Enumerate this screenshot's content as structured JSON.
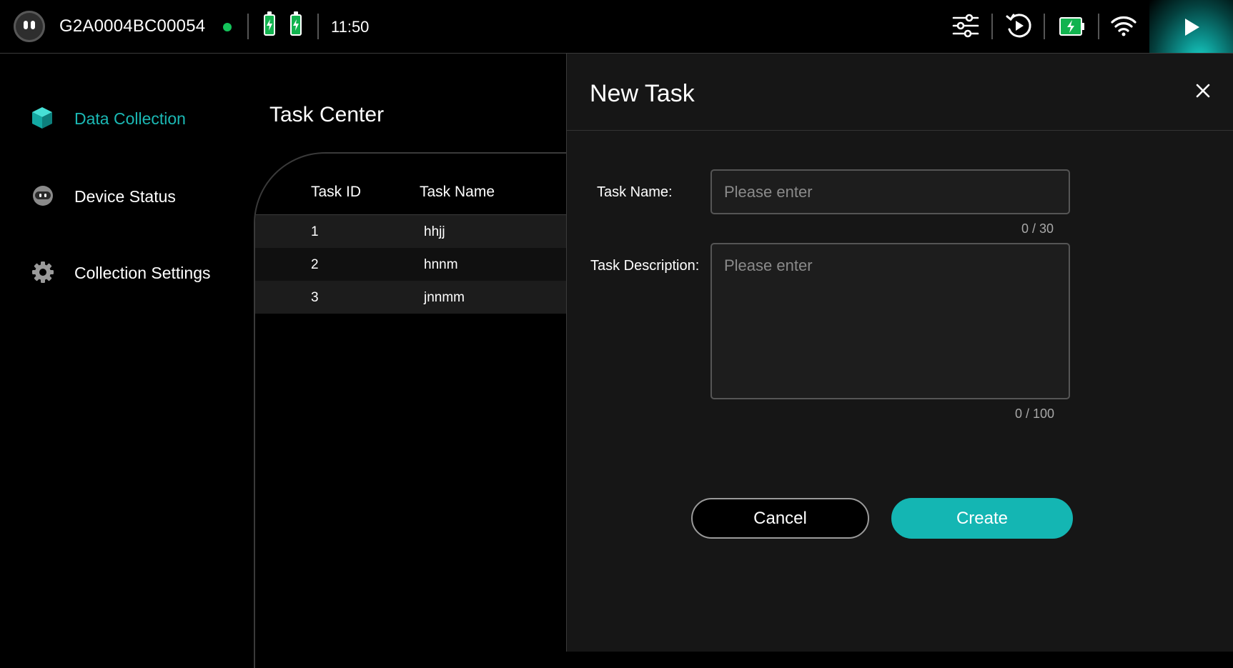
{
  "topbar": {
    "device_id": "G2A0004BC00054",
    "time": "11:50",
    "icons": [
      "logo-icon",
      "online-status-dot",
      "battery-1-icon",
      "battery-2-icon",
      "sliders-icon",
      "replay-icon",
      "charging-battery-icon",
      "wifi-icon",
      "play-icon"
    ],
    "colors": {
      "online": "#14c35a",
      "battery": "#12b34f",
      "accent": "#14b6b3"
    }
  },
  "sidebar": {
    "items": [
      {
        "label": "Data Collection",
        "icon": "cube-icon",
        "active": true
      },
      {
        "label": "Device Status",
        "icon": "robot-face-icon",
        "active": false
      },
      {
        "label": "Collection Settings",
        "icon": "gear-icon",
        "active": false
      }
    ]
  },
  "main": {
    "title": "Task Center",
    "table": {
      "headers": [
        "Task ID",
        "Task Name"
      ],
      "rows": [
        [
          "1",
          "hhjj"
        ],
        [
          "2",
          "hnnm"
        ],
        [
          "3",
          "jnnmm"
        ]
      ]
    }
  },
  "drawer": {
    "title": "New Task",
    "task_name_label": "Task Name:",
    "task_name_placeholder": "Please enter",
    "task_name_value": "",
    "task_name_counter": "0 / 30",
    "task_desc_label": "Task Description:",
    "task_desc_placeholder": "Please enter",
    "task_desc_value": "",
    "task_desc_counter": "0 / 100",
    "cancel_label": "Cancel",
    "create_label": "Create"
  }
}
